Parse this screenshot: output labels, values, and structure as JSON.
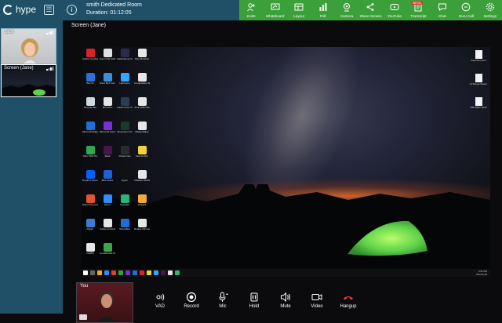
{
  "header": {
    "logo_text": "hype",
    "room_name": "smith Dedicated Room",
    "duration": "Duration: 01:12:05"
  },
  "toolbar": {
    "items": [
      {
        "label": "Invite",
        "icon": "invite-icon"
      },
      {
        "label": "Whiteboard",
        "icon": "whiteboard-icon"
      },
      {
        "label": "Layout",
        "icon": "layout-icon"
      },
      {
        "label": "Poll",
        "icon": "poll-icon"
      },
      {
        "label": "Camera",
        "icon": "camera-icon"
      },
      {
        "label": "Share Screen",
        "icon": "share-screen-icon"
      },
      {
        "label": "YouTube",
        "icon": "youtube-icon"
      },
      {
        "label": "Transcript",
        "icon": "transcript-icon",
        "badge": "BETA"
      },
      {
        "label": "Chat",
        "icon": "chat-icon"
      },
      {
        "label": "Guru Call",
        "icon": "guru-call-icon"
      },
      {
        "label": "Settings",
        "icon": "settings-icon"
      }
    ],
    "accent": "#3ca03a"
  },
  "sidebar": {
    "tiles": [
      {
        "label": "Jane"
      },
      {
        "label": "Screen (Jane)"
      }
    ]
  },
  "main": {
    "screen_title": "Screen (Jane)"
  },
  "desktop": {
    "icons": [
      {
        "label": "Adobe Creative Cloud",
        "color": "#d8232a"
      },
      {
        "label": "Zoom File Attribute",
        "color": "#e0e0e0"
      },
      {
        "label": "AdobeScout CC",
        "color": "#2b2b4a"
      },
      {
        "label": "Play Manifest",
        "color": "#e6e6e6"
      },
      {
        "label": "Box ID",
        "color": "#2f6fd6"
      },
      {
        "label": "Nitrol BLX Community",
        "color": "#3a8fd8"
      },
      {
        "label": "Lightroom",
        "color": "#31a8ff"
      },
      {
        "label": "Composition Studio 2020",
        "color": "#e6e6e6"
      },
      {
        "label": "Recycle Bin",
        "color": "#cfd8dc"
      },
      {
        "label": "MirrorPro",
        "color": "#e6e6e6"
      },
      {
        "label": "Adobe Fuse CC (Beta)",
        "color": "#2b3d4f"
      },
      {
        "label": "Junk 2019 Planning",
        "color": "#e6e6e6"
      },
      {
        "label": "Microsoft Edge",
        "color": "#1f6fd6"
      },
      {
        "label": "Microsoft Gameshow",
        "color": "#7a2fd6"
      },
      {
        "label": "Dimension CC",
        "color": "#1a3a2a"
      },
      {
        "label": "Media Maker",
        "color": "#e6e6e6"
      },
      {
        "label": "Nitro PDF Pro",
        "color": "#2fa84f"
      },
      {
        "label": "Slack",
        "color": "#4a154b"
      },
      {
        "label": "Virtual Cam",
        "color": "#2b2b2b"
      },
      {
        "label": "New Hobby",
        "color": "#f2d23a"
      },
      {
        "label": "Dropbox (Team Size)",
        "color": "#0061ff"
      },
      {
        "label": "Blue Jeans",
        "color": "#1f5fd6"
      },
      {
        "label": "Hyper",
        "color": "#111"
      },
      {
        "label": "VMware Workstation",
        "color": "#e6e6e6"
      },
      {
        "label": "Search Everything",
        "color": "#e0552e"
      },
      {
        "label": "Zoom",
        "color": "#2d8cff"
      },
      {
        "label": "Navigate",
        "color": "#2bb673"
      },
      {
        "label": "Inkage3",
        "color": "#f2a93a"
      },
      {
        "label": "Digiter",
        "color": "#3a7bd5"
      },
      {
        "label": "Adobe Acrobat",
        "color": "#e6e6e6"
      },
      {
        "label": "ShortsBee",
        "color": "#1f6fd6"
      },
      {
        "label": "Rebble Microsoft",
        "color": "#e6e6e6"
      },
      {
        "label": "NetBM",
        "color": "#e6e6e6"
      },
      {
        "label": "CorelDRAW 2020",
        "color": "#3aa845"
      }
    ],
    "right_icons": [
      {
        "label": "Asynchronous"
      },
      {
        "label": "AI Range Reserve"
      },
      {
        "label": "PBI Office 2016"
      }
    ],
    "taskbar_clock": [
      "3:52 PM",
      "06-Feb-20"
    ]
  },
  "self_view": {
    "label": "You"
  },
  "controls": [
    {
      "label": "VAD",
      "icon": "vad-icon"
    },
    {
      "label": "Record",
      "icon": "record-icon"
    },
    {
      "label": "Mic",
      "icon": "mic-icon"
    },
    {
      "label": "Hold",
      "icon": "hold-icon"
    },
    {
      "label": "Mute",
      "icon": "mute-icon"
    },
    {
      "label": "Video",
      "icon": "video-icon"
    },
    {
      "label": "Hangup",
      "icon": "hangup-icon",
      "color": "#e53935"
    }
  ]
}
